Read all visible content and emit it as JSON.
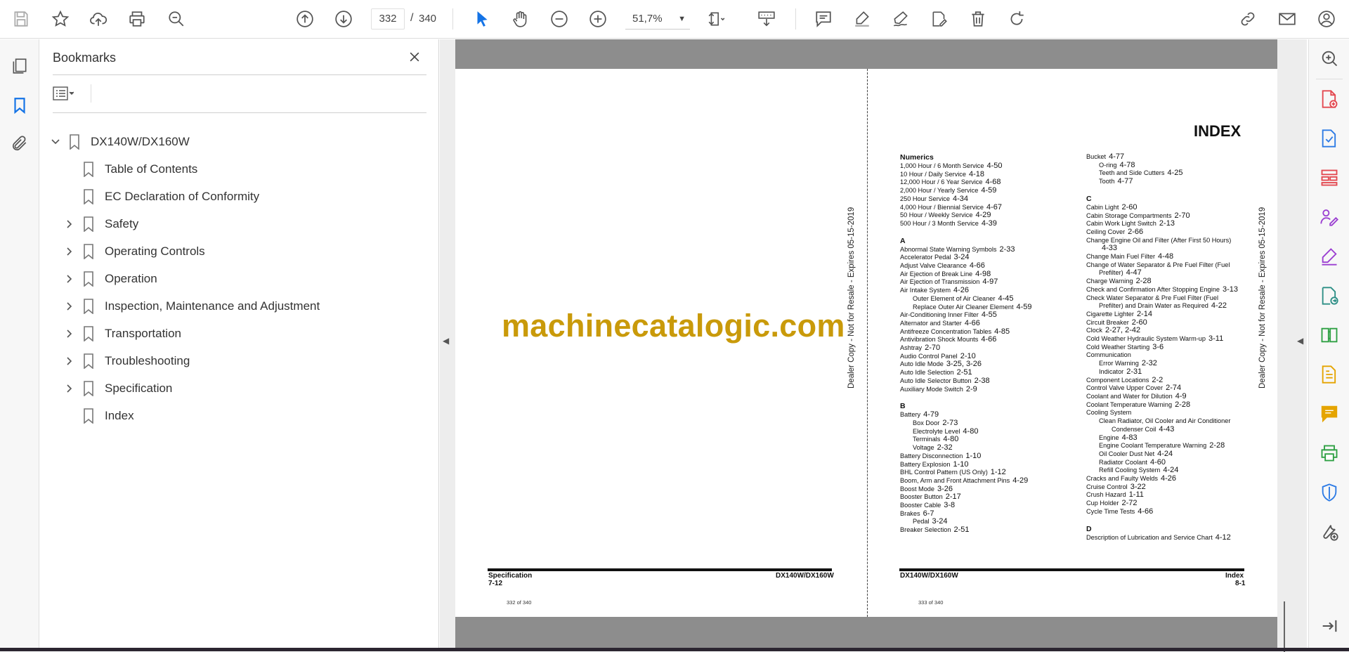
{
  "toolbar": {
    "page_current": "332",
    "page_separator": "/",
    "page_total": "340",
    "zoom": "51,7%",
    "icons": [
      "save-icon",
      "star-icon",
      "upload-icon",
      "print-icon",
      "zoom-search-icon",
      "page-up-icon",
      "page-down-icon",
      "select-cursor-icon",
      "hand-icon",
      "zoom-out-icon",
      "zoom-in-icon",
      "fit-page-icon",
      "scroll-mode-icon",
      "comment-icon",
      "highlight-icon",
      "sign-icon",
      "edit-pdf-icon",
      "delete-icon",
      "rotate-icon",
      "share-link-icon",
      "email-icon",
      "account-icon"
    ]
  },
  "bookmarks": {
    "title": "Bookmarks",
    "root": "DX140W/DX160W",
    "items": [
      {
        "label": "Table of Contents",
        "expandable": false
      },
      {
        "label": "EC Declaration of Conformity",
        "expandable": false
      },
      {
        "label": "Safety",
        "expandable": true
      },
      {
        "label": "Operating Controls",
        "expandable": true
      },
      {
        "label": "Operation",
        "expandable": true
      },
      {
        "label": "Inspection, Maintenance and Adjustment",
        "expandable": true
      },
      {
        "label": "Transportation",
        "expandable": true
      },
      {
        "label": "Troubleshooting",
        "expandable": true
      },
      {
        "label": "Specification",
        "expandable": true
      },
      {
        "label": "Index",
        "expandable": false
      }
    ]
  },
  "document": {
    "watermark": "machinecatalogic.com",
    "vertical_note": "Dealer Copy - Not for Resale - Expires 05-15-2019",
    "left_page": {
      "footer_section": "Specification",
      "footer_page": "7-12",
      "footer_model": "DX140W/DX160W",
      "page_counter": "332 of 340"
    },
    "right_page": {
      "title": "INDEX",
      "footer_model": "DX140W/DX160W",
      "footer_section": "Index",
      "footer_page": "8-1",
      "page_counter": "333 of 340",
      "col1": [
        {
          "t": "Numerics",
          "h": true
        },
        {
          "t": "1,000 Hour / 6 Month Service",
          "n": "4-50"
        },
        {
          "t": "10 Hour / Daily Service",
          "n": "4-18"
        },
        {
          "t": "12,000 Hour / 6 Year Service",
          "n": "4-68"
        },
        {
          "t": "2,000 Hour / Yearly Service",
          "n": "4-59"
        },
        {
          "t": "250 Hour Service",
          "n": "4-34"
        },
        {
          "t": "4,000 Hour / Biennial Service",
          "n": "4-67"
        },
        {
          "t": "50 Hour / Weekly Service",
          "n": "4-29"
        },
        {
          "t": "500 Hour / 3 Month Service",
          "n": "4-39"
        },
        {
          "gap": true
        },
        {
          "t": "A",
          "h": true
        },
        {
          "t": "Abnormal State Warning Symbols",
          "n": "2-33"
        },
        {
          "t": "Accelerator Pedal",
          "n": "3-24"
        },
        {
          "t": "Adjust Valve Clearance",
          "n": "4-66"
        },
        {
          "t": "Air Ejection of Break Line",
          "n": "4-98"
        },
        {
          "t": "Air Ejection of Transmission",
          "n": "4-97"
        },
        {
          "t": "Air Intake System",
          "n": "4-26"
        },
        {
          "t": "Outer Element of Air Cleaner",
          "n": "4-45",
          "i": 1
        },
        {
          "t": "Replace Outer Air Cleaner Element",
          "n": "4-59",
          "i": 1
        },
        {
          "t": "Air-Conditioning Inner Filter",
          "n": "4-55"
        },
        {
          "t": "Alternator and Starter",
          "n": "4-66"
        },
        {
          "t": "Antifreeze Concentration Tables",
          "n": "4-85"
        },
        {
          "t": "Antivibration Shock Mounts",
          "n": "4-66"
        },
        {
          "t": "Ashtray",
          "n": "2-70"
        },
        {
          "t": "Audio Control Panel",
          "n": "2-10"
        },
        {
          "t": "Auto Idle Mode",
          "n": "3-25, 3-26"
        },
        {
          "t": "Auto Idle Selection",
          "n": "2-51"
        },
        {
          "t": "Auto Idle Selector Button",
          "n": "2-38"
        },
        {
          "t": "Auxiliary Mode Switch",
          "n": "2-9"
        },
        {
          "gap": true
        },
        {
          "t": "B",
          "h": true
        },
        {
          "t": "Battery",
          "n": "4-79"
        },
        {
          "t": "Box Door",
          "n": "2-73",
          "i": 1
        },
        {
          "t": "Electrolyte Level",
          "n": "4-80",
          "i": 1
        },
        {
          "t": "Terminals",
          "n": "4-80",
          "i": 1
        },
        {
          "t": "Voltage",
          "n": "2-32",
          "i": 1
        },
        {
          "t": "Battery Disconnection",
          "n": "1-10"
        },
        {
          "t": "Battery Explosion",
          "n": "1-10"
        },
        {
          "t": "BHL Control Pattern (US Only)",
          "n": "1-12"
        },
        {
          "t": "Boom, Arm and Front Attachment Pins",
          "n": "4-29"
        },
        {
          "t": "Boost Mode",
          "n": "3-26"
        },
        {
          "t": "Booster Button",
          "n": "2-17"
        },
        {
          "t": "Booster Cable",
          "n": "3-8"
        },
        {
          "t": "Brakes",
          "n": "6-7"
        },
        {
          "t": "Pedal",
          "n": "3-24",
          "i": 1
        },
        {
          "t": "Breaker Selection",
          "n": "2-51"
        }
      ],
      "col2": [
        {
          "t": "Bucket",
          "n": "4-77"
        },
        {
          "t": "O-ring",
          "n": "4-78",
          "i": 1
        },
        {
          "t": "Teeth and Side Cutters",
          "n": "4-25",
          "i": 1
        },
        {
          "t": "Tooth",
          "n": "4-77",
          "i": 1
        },
        {
          "gap": true
        },
        {
          "t": "C",
          "h": true
        },
        {
          "t": "Cabin Light",
          "n": "2-60"
        },
        {
          "t": "Cabin Storage Compartments",
          "n": "2-70"
        },
        {
          "t": "Cabin Work Light Switch",
          "n": "2-13"
        },
        {
          "t": "Ceiling Cover",
          "n": "2-66"
        },
        {
          "t": "Change Engine Oil and Filter (After First 50 Hours)",
          "n": ""
        },
        {
          "t": "",
          "n": "4-33",
          "i": 1
        },
        {
          "t": "Change Main Fuel Filter",
          "n": "4-48"
        },
        {
          "t": "Change of Water Separator & Pre Fuel Filter (Fuel",
          "n": ""
        },
        {
          "t": "Prefilter)",
          "n": "4-47",
          "i": 1
        },
        {
          "t": "Charge Warning",
          "n": "2-28"
        },
        {
          "t": "Check and Confirmation After Stopping Engine",
          "n": "3-13"
        },
        {
          "t": "Check Water Separator & Pre Fuel Filter (Fuel",
          "n": ""
        },
        {
          "t": "Prefilter) and Drain Water as Required",
          "n": "4-22",
          "i": 1
        },
        {
          "t": "Cigarette Lighter",
          "n": "2-14"
        },
        {
          "t": "Circuit Breaker",
          "n": "2-60"
        },
        {
          "t": "Clock",
          "n": "2-27, 2-42"
        },
        {
          "t": "Cold Weather Hydraulic System Warm-up",
          "n": "3-11"
        },
        {
          "t": "Cold Weather Starting",
          "n": "3-6"
        },
        {
          "t": "Communication",
          "n": ""
        },
        {
          "t": "Error Warning",
          "n": "2-32",
          "i": 1
        },
        {
          "t": "Indicator",
          "n": "2-31",
          "i": 1
        },
        {
          "t": "Component Locations",
          "n": "2-2"
        },
        {
          "t": "Control Valve Upper Cover",
          "n": "2-74"
        },
        {
          "t": "Coolant and Water for Dilution",
          "n": "4-9"
        },
        {
          "t": "Coolant Temperature Warning",
          "n": "2-28"
        },
        {
          "t": "Cooling System",
          "n": ""
        },
        {
          "t": "Clean Radiator, Oil Cooler and Air Conditioner",
          "n": "",
          "i": 1
        },
        {
          "t": "Condenser Coil",
          "n": "4-43",
          "i": 2
        },
        {
          "t": "Engine",
          "n": "4-83",
          "i": 1
        },
        {
          "t": "Engine Coolant Temperature Warning",
          "n": "2-28",
          "i": 1
        },
        {
          "t": "Oil Cooler Dust Net",
          "n": "4-24",
          "i": 1
        },
        {
          "t": "Radiator Coolant",
          "n": "4-60",
          "i": 1
        },
        {
          "t": "Refill Cooling System",
          "n": "4-24",
          "i": 1
        },
        {
          "t": "Cracks and Faulty Welds",
          "n": "4-26"
        },
        {
          "t": "Cruise Control",
          "n": "3-22"
        },
        {
          "t": "Crush Hazard",
          "n": "1-11"
        },
        {
          "t": "Cup Holder",
          "n": "2-72"
        },
        {
          "t": "Cycle Time Tests",
          "n": "4-66"
        },
        {
          "gap": true
        },
        {
          "t": "D",
          "h": true
        },
        {
          "t": "Description of Lubrication and Service Chart",
          "n": "4-12"
        }
      ]
    }
  }
}
